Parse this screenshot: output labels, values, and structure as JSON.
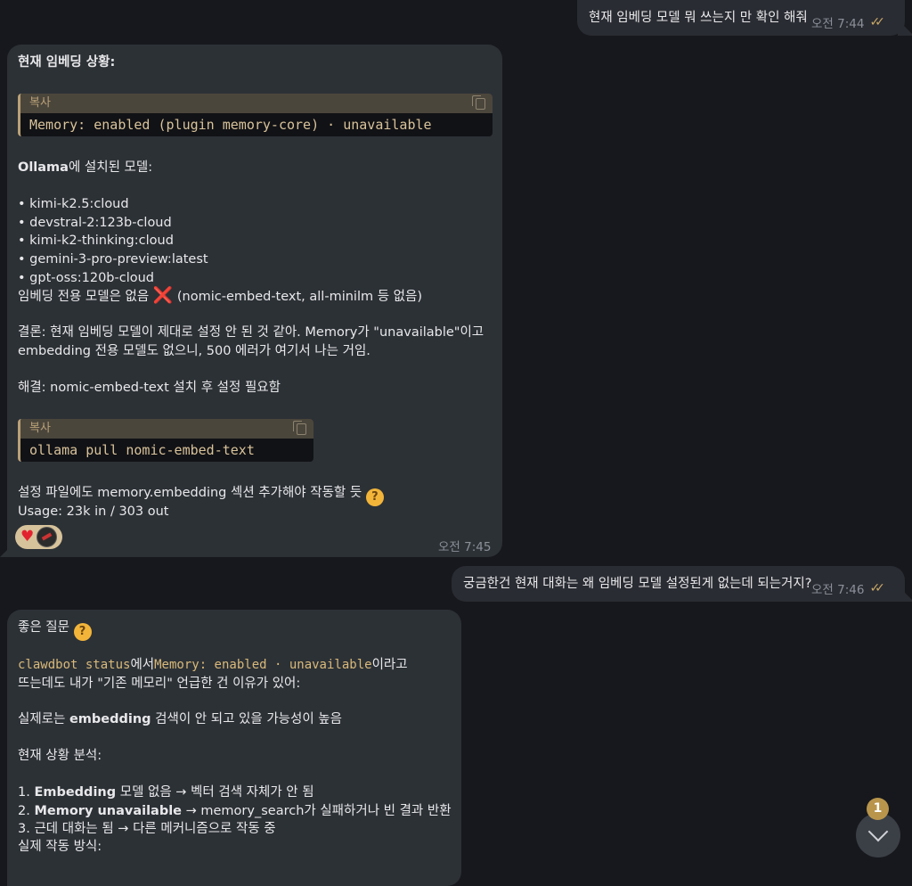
{
  "messages": {
    "m1": {
      "text": "현재 임베딩 모델 뭐 쓰는지 만 확인 해줘",
      "time": "오전 7:44"
    },
    "m2": {
      "heading": "현재 임베딩 상황:",
      "code1": {
        "label": "복사",
        "text": "Memory: enabled (plugin memory-core) · unavailable"
      },
      "ollama_bold": "Ollama",
      "ollama_rest": "에 설치된 모델:",
      "models": [
        "• kimi-k2.5:cloud",
        "• devstral-2:123b-cloud",
        "• kimi-k2-thinking:cloud",
        "• gemini-3-pro-preview:latest",
        "• gpt-oss:120b-cloud"
      ],
      "no_embed_a": "임베딩 전용 모델은 없음",
      "no_embed_mark": "❌",
      "no_embed_b": "(nomic-embed-text, all-minilm 등 없음)",
      "conclusion_1": "결론: 현재 임베딩 모델이 제대로 설정 안 된 것 같아. Memory가 \"unavailable\"이고",
      "conclusion_2": "embedding 전용 모델도 없으니, 500 에러가 여기서 나는 거임.",
      "solution": "해결: nomic-embed-text 설치 후 설정 필요함",
      "code2": {
        "label": "복사",
        "text": "ollama pull nomic-embed-text"
      },
      "config_line": "설정 파일에도 memory.embedding 섹션 추가해야 작동할 듯",
      "usage": "Usage: 23k in / 303 out",
      "time": "오전 7:45",
      "reactions": [
        "heart",
        "avatar"
      ]
    },
    "m3": {
      "text": "궁금한건 현재 대화는 왜 임베딩 모델 설정된게 없는데 되는거지?",
      "time": "오전 7:46"
    },
    "m4": {
      "line1": "좋은 질문",
      "line2_code1": "clawdbot status",
      "line2_mid": "에서",
      "line2_code2": "Memory: enabled · unavailable",
      "line2_end": "이라고",
      "line3": "뜨는데도 내가 \"기존 메모리\" 언급한 건 이유가 있어:",
      "line4_a": "실제로는 ",
      "line4_bold": "embedding",
      "line4_b": " 검색이 안 되고 있을 가능성이 높음",
      "line5": "현재 상황 분석:",
      "item1_num": "1. ",
      "item1_bold": "Embedding",
      "item1_rest": " 모델 없음 → 벡터 검색 자체가 안 됨",
      "item2_num": "2. ",
      "item2_bold": "Memory unavailable",
      "item2_rest": " → memory_search가 실패하거나 빈 결과 반환",
      "item3": "3. 근데 대화는 됨 → 다른 메커니즘으로 작동 중",
      "line_last": "실제 작동 방식:"
    }
  },
  "scroll": {
    "badge": "1"
  },
  "colors": {
    "background": "#17181d",
    "incoming": "#2c3136",
    "outgoing": "#2a2c33",
    "accent": "#c9a866"
  }
}
